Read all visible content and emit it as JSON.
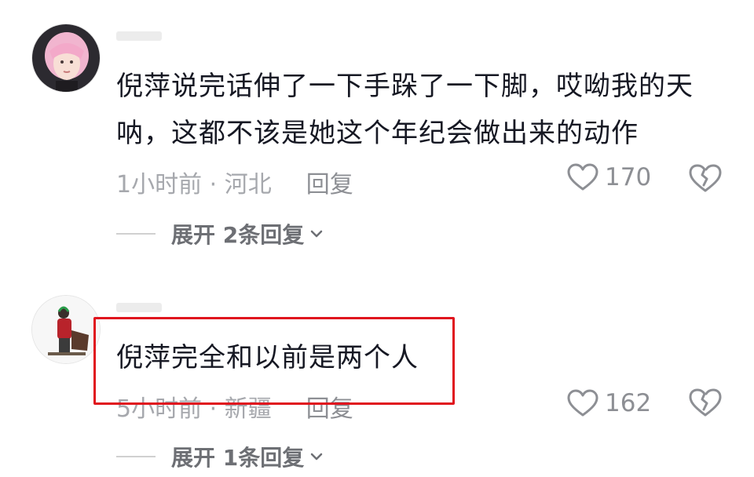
{
  "comments": [
    {
      "text": "倪萍说完话伸了一下手跺了一下脚，哎呦我的天呐，这都不该是她这个年纪会做出来的动作",
      "meta": "1小时前 · 河北",
      "reply_label": "回复",
      "likes": "170",
      "expand_label": "展开 2条回复",
      "avatar_icon": "user-avatar-pink-hair"
    },
    {
      "text": "倪萍完全和以前是两个人",
      "meta": "5小时前 · 新疆",
      "reply_label": "回复",
      "likes": "162",
      "expand_label": "展开 1条回复",
      "avatar_icon": "user-avatar-figure",
      "highlighted": true
    }
  ],
  "colors": {
    "highlight_border": "#e0141e",
    "meta_text": "#a6a8ad",
    "body_text": "#161823"
  }
}
